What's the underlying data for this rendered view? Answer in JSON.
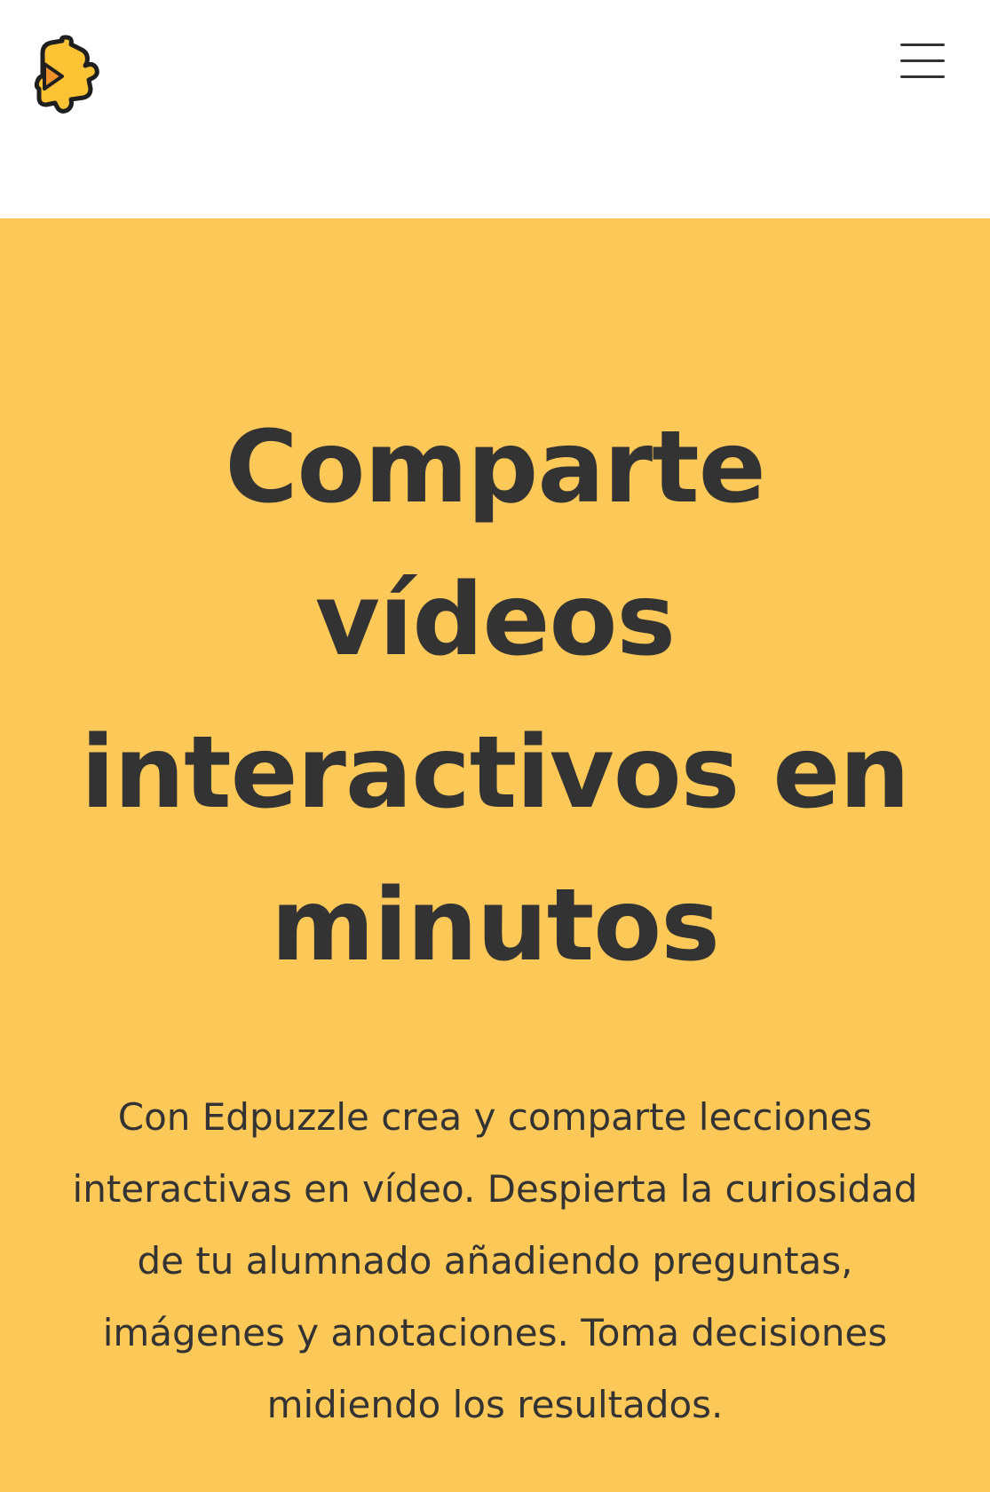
{
  "header": {
    "logo_icon": "edpuzzle-puzzle-play-logo",
    "menu_icon": "hamburger-menu-icon"
  },
  "hero": {
    "title": "Comparte vídeos interactivos en minutos",
    "description": "Con Edpuzzle crea y comparte lecciones interactivas en vídeo. Despierta la curiosidad de tu alumnado añadiendo preguntas, imágenes y anotaciones. Toma decisiones midiendo los resultados."
  },
  "colors": {
    "hero_background": "#fcc857",
    "text": "#333333",
    "logo_yellow": "#fcc435",
    "logo_orange": "#f0922b",
    "logo_outline": "#1f1f1f"
  }
}
